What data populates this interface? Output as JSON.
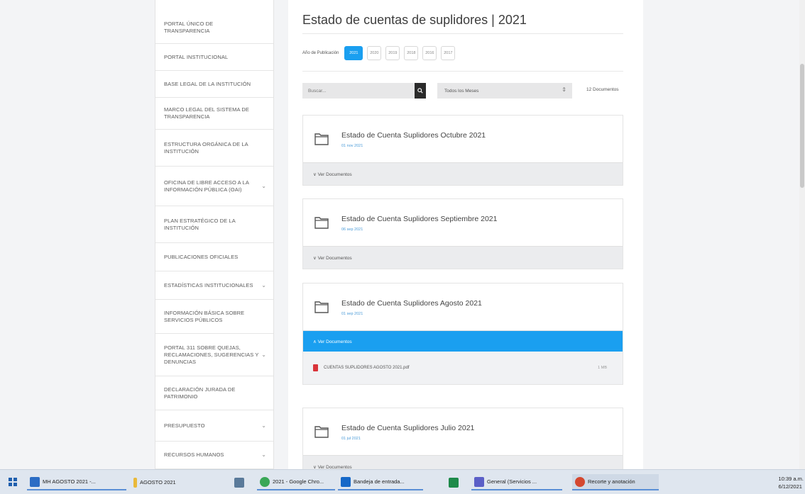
{
  "sidebar": {
    "items": [
      {
        "label": "PORTAL ÚNICO DE TRANSPARENCIA",
        "chevron": ""
      },
      {
        "label": "PORTAL INSTITUCIONAL",
        "chevron": ""
      },
      {
        "label": "BASE LEGAL DE LA INSTITUCIÓN",
        "chevron": ""
      },
      {
        "label": "MARCO LEGAL DEL SISTEMA DE TRANSPARENCIA",
        "chevron": ""
      },
      {
        "label": "ESTRUCTURA ORGÁNICA DE LA INSTITUCIÓN",
        "chevron": ""
      },
      {
        "label": "OFICINA DE LIBRE ACCESO A LA INFORMACIÓN PÚBLICA (OAI)",
        "chevron": "⌄"
      },
      {
        "label": "PLAN ESTRATÉGICO DE LA INSTITUCIÓN",
        "chevron": ""
      },
      {
        "label": "PUBLICACIONES OFICIALES",
        "chevron": ""
      },
      {
        "label": "ESTADÍSTICAS INSTITUCIONALES",
        "chevron": "⌄"
      },
      {
        "label": "INFORMACIÓN BÁSICA SOBRE SERVICIOS PÚBLICOS",
        "chevron": ""
      },
      {
        "label": "PORTAL 311 SOBRE QUEJAS, RECLAMACIONES, SUGERENCIAS Y DENUNCIAS",
        "chevron": "⌄"
      },
      {
        "label": "DECLARACIÓN JURADA DE PATRIMONIO",
        "chevron": ""
      },
      {
        "label": "PRESUPUESTO",
        "chevron": "⌄"
      },
      {
        "label": "RECURSOS HUMANOS",
        "chevron": "⌄"
      }
    ]
  },
  "main": {
    "title": "Estado de cuentas de suplidores | 2021",
    "years_label": "Año de Publicación",
    "years": [
      "2021",
      "2020",
      "2019",
      "2018",
      "2016",
      "2017"
    ],
    "active_year_index": 0,
    "search_placeholder": "Buscar...",
    "month_select": "Todos los Meses",
    "doc_count": "12 Documentos",
    "cards": [
      {
        "title": "Estado de Cuenta Suplidores Octubre 2021",
        "date": "01 nov 2021",
        "toggle": "∨  Ver Documentos",
        "expanded": false
      },
      {
        "title": "Estado de Cuenta Suplidores Septiembre 2021",
        "date": "06 sep 2021",
        "toggle": "∨  Ver Documentos",
        "expanded": false
      },
      {
        "title": "Estado de Cuenta Suplidores Agosto 2021",
        "date": "01 sep 2021",
        "toggle": "∧  Ver Documentos",
        "expanded": true,
        "document": {
          "name": "CUENTAS SUPLIDORES AGOSTO 2021.pdf",
          "size": "1 MB"
        }
      },
      {
        "title": "Estado de Cuenta Suplidores Julio 2021",
        "date": "01 jul 2021",
        "toggle": "∨  Ver Documentos",
        "expanded": false
      }
    ]
  },
  "taskbar": {
    "items": [
      {
        "label": "MH AGOSTO 2021 -...",
        "icon_color": "#2b6cc4"
      },
      {
        "label": "AGOSTO 2021",
        "icon_color": "#e9b93a"
      },
      {
        "label": "",
        "icon_color": "#5a7a9a"
      },
      {
        "label": "2021 - Google Chro...",
        "icon_color": "#3aa757"
      },
      {
        "label": "Bandeja de entrada...",
        "icon_color": "#1668c8"
      },
      {
        "label": "",
        "icon_color": "#1e8a4a"
      },
      {
        "label": "General (Servicios ...",
        "icon_color": "#5b5fc7"
      },
      {
        "label": "Recorte y anotación",
        "icon_color": "#d4472f"
      }
    ],
    "clock_time": "10:39 a.m.",
    "clock_date": "6/12/2021"
  }
}
